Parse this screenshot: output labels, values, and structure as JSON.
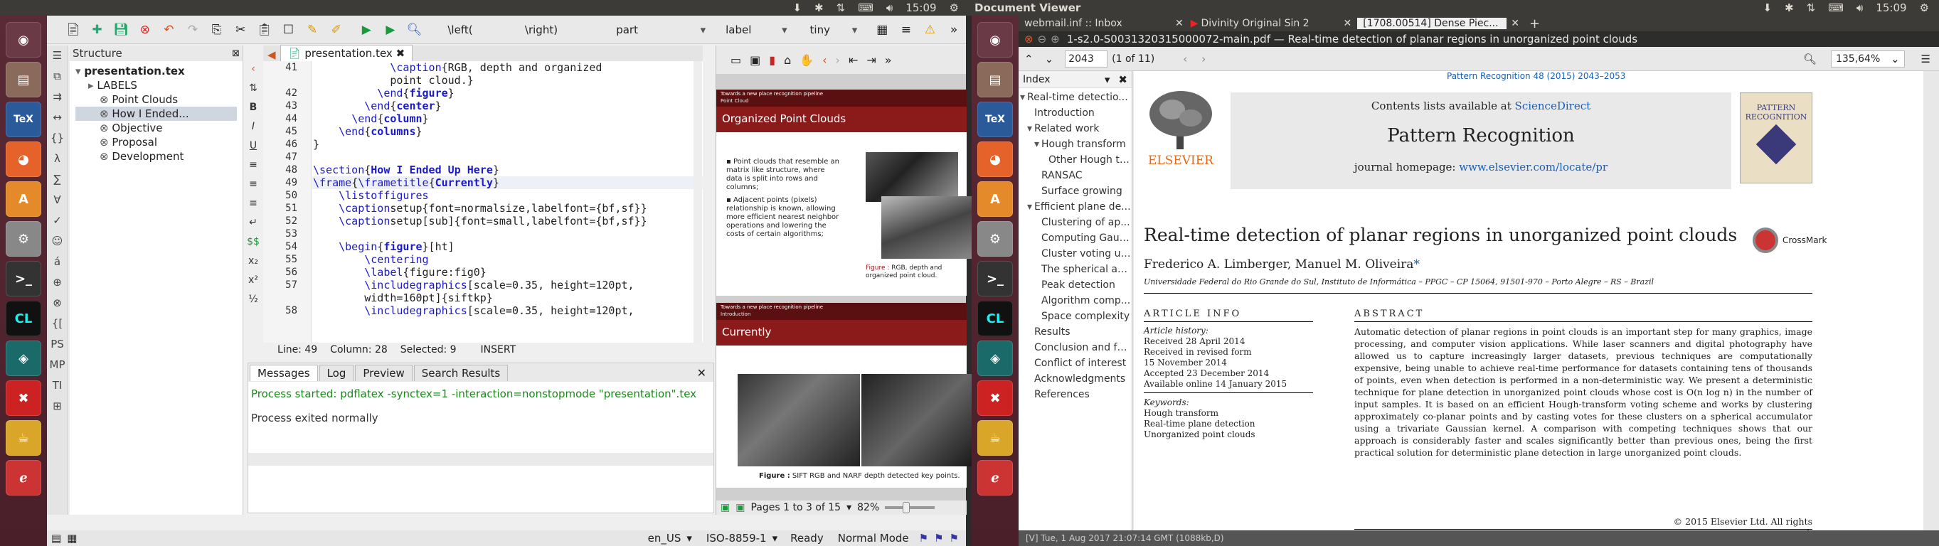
{
  "left_panel": {
    "time": "15:09"
  },
  "right_panel": {
    "app": "Document Viewer",
    "time": "15:09"
  },
  "launcher_left": [
    "ubuntu",
    "files",
    "texstudio",
    "firefox",
    "software",
    "settings",
    "terminal",
    "clion",
    "gitkraken",
    "xchat",
    "ambiance",
    "tweaks"
  ],
  "texstudio": {
    "toolbar_items": {
      "left_brace": "\\left(",
      "right_brace": "\\right)",
      "part": "part",
      "label": "label",
      "tiny": "tiny"
    },
    "structure": {
      "title": "Structure",
      "root": "presentation.tex",
      "labels": "LABELS",
      "items": [
        "Point Clouds",
        "How I Ended...",
        "Objective",
        "Proposal",
        "Development"
      ]
    },
    "editor_tab": "presentation.tex",
    "lines": [
      {
        "n": "41",
        "t": "            \\caption{RGB, depth and organized"
      },
      {
        "n": "",
        "t": "            point cloud.}"
      },
      {
        "n": "42",
        "t": "          \\end{figure}"
      },
      {
        "n": "43",
        "t": "        \\end{center}"
      },
      {
        "n": "44",
        "t": "      \\end{column}"
      },
      {
        "n": "45",
        "t": "    \\end{columns}"
      },
      {
        "n": "46",
        "t": "}"
      },
      {
        "n": "47",
        "t": ""
      },
      {
        "n": "48",
        "t": "\\section{How I Ended Up Here}"
      },
      {
        "n": "49",
        "t": "\\frame{\\frametitle{Currently}"
      },
      {
        "n": "50",
        "t": "    \\listoffigures"
      },
      {
        "n": "51",
        "t": "    \\captionsetup{font=normalsize,labelfont={bf,sf}}"
      },
      {
        "n": "52",
        "t": "    \\captionsetup[sub]{font=small,labelfont={bf,sf}}"
      },
      {
        "n": "53",
        "t": ""
      },
      {
        "n": "54",
        "t": "    \\begin{figure}[ht]"
      },
      {
        "n": "55",
        "t": "        \\centering"
      },
      {
        "n": "56",
        "t": "        \\label{figure:fig0}"
      },
      {
        "n": "57",
        "t": "        \\includegraphics[scale=0.35, height=120pt,"
      },
      {
        "n": "",
        "t": "        width=160pt]{siftkp}"
      },
      {
        "n": "58",
        "t": "        \\includegraphics[scale=0.35, height=120pt,"
      }
    ],
    "status": {
      "line": "Line: 49",
      "column": "Column: 28",
      "selected": "Selected: 9",
      "mode": "INSERT"
    },
    "msg_tabs": [
      "Messages",
      "Log",
      "Preview",
      "Search Results"
    ],
    "messages": [
      "Process started: pdflatex -synctex=1 -interaction=nonstopmode \"presentation\".tex",
      "Process exited normally"
    ],
    "preview": {
      "slide1_header": "Towards a new place recognition pipeline",
      "slide1_sub": "Point Cloud",
      "slide1_title": "Organized Point Clouds",
      "bullet1": "Point clouds that resemble an matrix like structure, where data is split into rows and columns;",
      "bullet2": "Adjacent points (pixels) relationship is known, allowing more efficient nearest neighbor operations and lowering the costs of certain algorithms;",
      "fig1_label": "Figure :",
      "fig1_caption": "RGB, depth and organized point cloud.",
      "slide2_header": "Towards a new place recognition pipeline",
      "slide2_sub": "Introduction",
      "slide2_title": "Currently",
      "fig2_label": "Figure :",
      "fig2_caption": "SIFT RGB and NARF depth detected key points.",
      "pages": "Pages 1 to 3 of 15",
      "zoom": "82%"
    },
    "bottom_status": {
      "lang": "en_US",
      "encoding": "ISO-8859-1",
      "ready": "Ready",
      "mode": "Normal Mode"
    }
  },
  "docviewer": {
    "tabs": [
      "webmail.inf :: Inbox",
      "Divinity Original Sin 2",
      "[1708.00514] Dense Piec..."
    ],
    "title": "1-s2.0-S0031320315000072-main.pdf — Real-time detection of planar regions in unorganized point clouds",
    "page_field": "2043",
    "page_of": "(1 of 11)",
    "zoom": "135,64%",
    "index_label": "Index",
    "index": [
      {
        "t": "Real-time detectio...",
        "lvl": 0,
        "arrow": "▾"
      },
      {
        "t": "Introduction",
        "lvl": 1,
        "arrow": ""
      },
      {
        "t": "Related work",
        "lvl": 1,
        "arrow": "▾"
      },
      {
        "t": "Hough transform",
        "lvl": 2,
        "arrow": "▾"
      },
      {
        "t": "Other Hough tr...",
        "lvl": 3,
        "arrow": ""
      },
      {
        "t": "RANSAC",
        "lvl": 2,
        "arrow": ""
      },
      {
        "t": "Surface growing",
        "lvl": 2,
        "arrow": ""
      },
      {
        "t": "Efficient plane de...",
        "lvl": 1,
        "arrow": "▾"
      },
      {
        "t": "Clustering of ap...",
        "lvl": 2,
        "arrow": ""
      },
      {
        "t": "Computing Gaus...",
        "lvl": 2,
        "arrow": ""
      },
      {
        "t": "Cluster voting us...",
        "lvl": 2,
        "arrow": ""
      },
      {
        "t": "The spherical ac...",
        "lvl": 2,
        "arrow": ""
      },
      {
        "t": "Peak detection",
        "lvl": 2,
        "arrow": ""
      },
      {
        "t": "Algorithm comp...",
        "lvl": 2,
        "arrow": ""
      },
      {
        "t": "Space complexity",
        "lvl": 2,
        "arrow": ""
      },
      {
        "t": "Results",
        "lvl": 1,
        "arrow": ""
      },
      {
        "t": "Conclusion and fu...",
        "lvl": 1,
        "arrow": ""
      },
      {
        "t": "Conflict of interest",
        "lvl": 1,
        "arrow": ""
      },
      {
        "t": "Acknowledgments",
        "lvl": 1,
        "arrow": ""
      },
      {
        "t": "References",
        "lvl": 1,
        "arrow": ""
      }
    ],
    "pdf": {
      "top_ref": "Pattern Recognition 48 (2015) 2043–2053",
      "contents": "Contents lists available at ",
      "sciencedirect": "ScienceDirect",
      "journal": "Pattern Recognition",
      "homepage": "journal homepage: ",
      "homepage_url": "www.elsevier.com/locate/pr",
      "elsevier": "ELSEVIER",
      "cover": "PATTERN RECOGNITION",
      "crossmark": "CrossMark",
      "title": "Real-time detection of planar regions in unorganized point clouds",
      "authors": "Frederico A. Limberger, Manuel M. Oliveira",
      "star": "*",
      "affil": "Universidade Federal do Rio Grande do Sul, Instituto de Informática – PPGC – CP 15064, 91501-970 – Porto Alegre – RS – Brazil",
      "article_info": "ARTICLE INFO",
      "history_title": "Article history:",
      "history": [
        "Received 28 April 2014",
        "Received in revised form",
        "15 November 2014",
        "Accepted 23 December 2014",
        "Available online 14 January 2015"
      ],
      "keywords_title": "Keywords:",
      "keywords": [
        "Hough transform",
        "Real-time plane detection",
        "Unorganized point clouds"
      ],
      "abstract_title": "ABSTRACT",
      "abstract": "Automatic detection of planar regions in point clouds is an important step for many graphics, image processing, and computer vision applications. While laser scanners and digital photography have allowed us to capture increasingly larger datasets, previous techniques are computationally expensive, being unable to achieve real-time performance for datasets containing tens of thousands of points, even when detection is performed in a non-deterministic way. We present a deterministic technique for plane detection in unorganized point clouds whose cost is O(n log n) in the number of input samples. It is based on an efficient Hough-transform voting scheme and works by clustering approximately co-planar points and by casting votes for these clusters on a spherical accumulator using a trivariate Gaussian kernel. A comparison with competing techniques shows that our approach is considerably faster and scales significantly better than previous ones, being the first practical solution for deterministic plane detection in large unorganized point clouds.",
      "copyright": "© 2015 Elsevier Ltd. All rights reserved.",
      "footer": "[V] Tue, 1 Aug 2017 21:07:14 GMT (1088kb,D)"
    }
  },
  "colors": {
    "texstudio_kw": "#1a1acc",
    "slide_red": "#8b1a1a",
    "launcher": "#5a2a36",
    "link": "#1a5fb4"
  }
}
